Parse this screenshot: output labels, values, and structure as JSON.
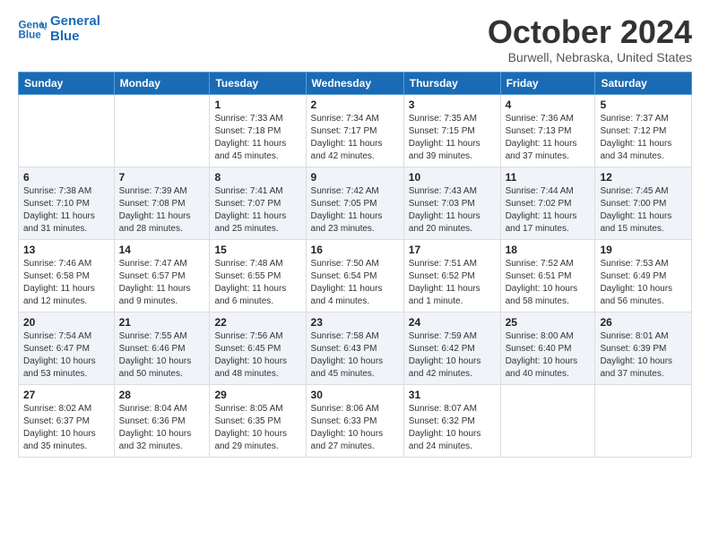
{
  "header": {
    "logo_line1": "General",
    "logo_line2": "Blue",
    "month": "October 2024",
    "location": "Burwell, Nebraska, United States"
  },
  "weekdays": [
    "Sunday",
    "Monday",
    "Tuesday",
    "Wednesday",
    "Thursday",
    "Friday",
    "Saturday"
  ],
  "weeks": [
    [
      {
        "day": "",
        "info": ""
      },
      {
        "day": "",
        "info": ""
      },
      {
        "day": "1",
        "info": "Sunrise: 7:33 AM\nSunset: 7:18 PM\nDaylight: 11 hours and 45 minutes."
      },
      {
        "day": "2",
        "info": "Sunrise: 7:34 AM\nSunset: 7:17 PM\nDaylight: 11 hours and 42 minutes."
      },
      {
        "day": "3",
        "info": "Sunrise: 7:35 AM\nSunset: 7:15 PM\nDaylight: 11 hours and 39 minutes."
      },
      {
        "day": "4",
        "info": "Sunrise: 7:36 AM\nSunset: 7:13 PM\nDaylight: 11 hours and 37 minutes."
      },
      {
        "day": "5",
        "info": "Sunrise: 7:37 AM\nSunset: 7:12 PM\nDaylight: 11 hours and 34 minutes."
      }
    ],
    [
      {
        "day": "6",
        "info": "Sunrise: 7:38 AM\nSunset: 7:10 PM\nDaylight: 11 hours and 31 minutes."
      },
      {
        "day": "7",
        "info": "Sunrise: 7:39 AM\nSunset: 7:08 PM\nDaylight: 11 hours and 28 minutes."
      },
      {
        "day": "8",
        "info": "Sunrise: 7:41 AM\nSunset: 7:07 PM\nDaylight: 11 hours and 25 minutes."
      },
      {
        "day": "9",
        "info": "Sunrise: 7:42 AM\nSunset: 7:05 PM\nDaylight: 11 hours and 23 minutes."
      },
      {
        "day": "10",
        "info": "Sunrise: 7:43 AM\nSunset: 7:03 PM\nDaylight: 11 hours and 20 minutes."
      },
      {
        "day": "11",
        "info": "Sunrise: 7:44 AM\nSunset: 7:02 PM\nDaylight: 11 hours and 17 minutes."
      },
      {
        "day": "12",
        "info": "Sunrise: 7:45 AM\nSunset: 7:00 PM\nDaylight: 11 hours and 15 minutes."
      }
    ],
    [
      {
        "day": "13",
        "info": "Sunrise: 7:46 AM\nSunset: 6:58 PM\nDaylight: 11 hours and 12 minutes."
      },
      {
        "day": "14",
        "info": "Sunrise: 7:47 AM\nSunset: 6:57 PM\nDaylight: 11 hours and 9 minutes."
      },
      {
        "day": "15",
        "info": "Sunrise: 7:48 AM\nSunset: 6:55 PM\nDaylight: 11 hours and 6 minutes."
      },
      {
        "day": "16",
        "info": "Sunrise: 7:50 AM\nSunset: 6:54 PM\nDaylight: 11 hours and 4 minutes."
      },
      {
        "day": "17",
        "info": "Sunrise: 7:51 AM\nSunset: 6:52 PM\nDaylight: 11 hours and 1 minute."
      },
      {
        "day": "18",
        "info": "Sunrise: 7:52 AM\nSunset: 6:51 PM\nDaylight: 10 hours and 58 minutes."
      },
      {
        "day": "19",
        "info": "Sunrise: 7:53 AM\nSunset: 6:49 PM\nDaylight: 10 hours and 56 minutes."
      }
    ],
    [
      {
        "day": "20",
        "info": "Sunrise: 7:54 AM\nSunset: 6:47 PM\nDaylight: 10 hours and 53 minutes."
      },
      {
        "day": "21",
        "info": "Sunrise: 7:55 AM\nSunset: 6:46 PM\nDaylight: 10 hours and 50 minutes."
      },
      {
        "day": "22",
        "info": "Sunrise: 7:56 AM\nSunset: 6:45 PM\nDaylight: 10 hours and 48 minutes."
      },
      {
        "day": "23",
        "info": "Sunrise: 7:58 AM\nSunset: 6:43 PM\nDaylight: 10 hours and 45 minutes."
      },
      {
        "day": "24",
        "info": "Sunrise: 7:59 AM\nSunset: 6:42 PM\nDaylight: 10 hours and 42 minutes."
      },
      {
        "day": "25",
        "info": "Sunrise: 8:00 AM\nSunset: 6:40 PM\nDaylight: 10 hours and 40 minutes."
      },
      {
        "day": "26",
        "info": "Sunrise: 8:01 AM\nSunset: 6:39 PM\nDaylight: 10 hours and 37 minutes."
      }
    ],
    [
      {
        "day": "27",
        "info": "Sunrise: 8:02 AM\nSunset: 6:37 PM\nDaylight: 10 hours and 35 minutes."
      },
      {
        "day": "28",
        "info": "Sunrise: 8:04 AM\nSunset: 6:36 PM\nDaylight: 10 hours and 32 minutes."
      },
      {
        "day": "29",
        "info": "Sunrise: 8:05 AM\nSunset: 6:35 PM\nDaylight: 10 hours and 29 minutes."
      },
      {
        "day": "30",
        "info": "Sunrise: 8:06 AM\nSunset: 6:33 PM\nDaylight: 10 hours and 27 minutes."
      },
      {
        "day": "31",
        "info": "Sunrise: 8:07 AM\nSunset: 6:32 PM\nDaylight: 10 hours and 24 minutes."
      },
      {
        "day": "",
        "info": ""
      },
      {
        "day": "",
        "info": ""
      }
    ]
  ]
}
